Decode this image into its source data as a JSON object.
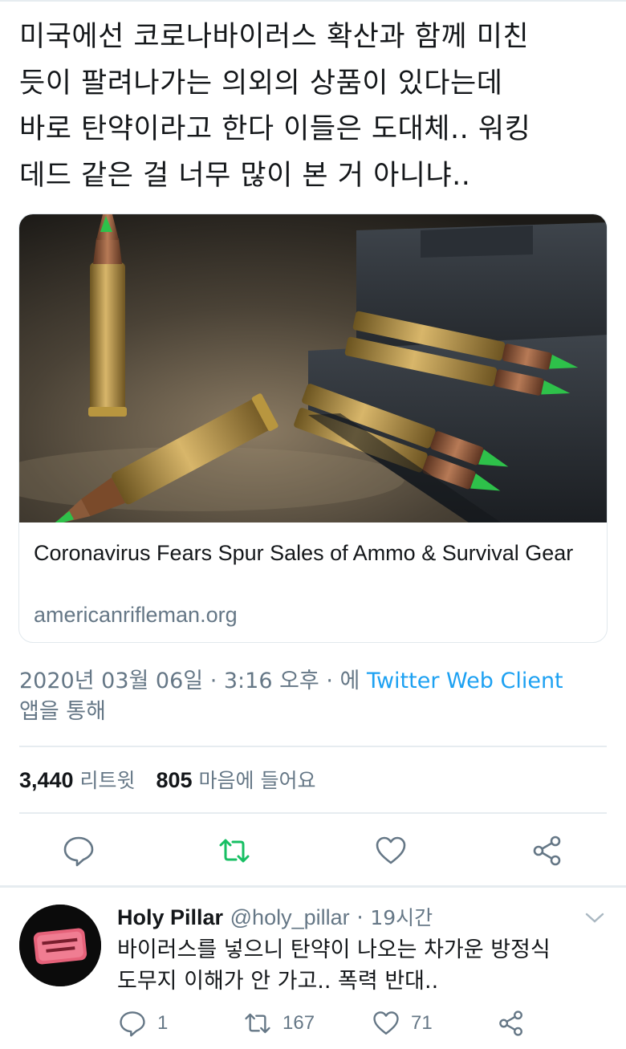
{
  "tweet": {
    "text": "미국에선 코로나바이러스 확산과 함께 미친\n듯이 팔려나가는 의외의 상품이 있다는데\n바로 탄약이라고 한다 이들은 도대체.. 워킹\n데드 같은 걸 너무 많이 본 거 아니냐..",
    "card": {
      "image_icon": "ammunition-photo",
      "title": "Coronavirus Fears Spur Sales of Ammo & Survival Gear",
      "domain": "americanrifleman.org"
    },
    "meta": {
      "date": "2020년 03월 06일",
      "sep1": " · ",
      "time": "3:16 오후",
      "sep2": " · 에 ",
      "client": "Twitter Web Client",
      "suffix": "앱을 통해"
    },
    "stats": {
      "retweets_count": "3,440",
      "retweets_label": "리트윗",
      "likes_count": "805",
      "likes_label": "마음에 들어요"
    },
    "actions": [
      {
        "name": "reply",
        "icon": "comment-icon"
      },
      {
        "name": "retweet",
        "icon": "retweet-icon"
      },
      {
        "name": "like",
        "icon": "heart-icon"
      },
      {
        "name": "share",
        "icon": "share-icon"
      }
    ]
  },
  "reply": {
    "avatar_icon": "fight-club-soap-avatar",
    "name": "Holy Pillar",
    "handle": "@holy_pillar",
    "separator": " · ",
    "time": "19시간",
    "text": "바이러스를 넣으니 탄약이 나오는 차가운 방정식\n도무지 이해가 안 가고.. 폭력 반대..",
    "reply_count": "1",
    "retweet_count": "167",
    "like_count": "71"
  },
  "colors": {
    "text": "#14171a",
    "secondary": "#657786",
    "link": "#1da1f2",
    "retweet_active": "#17bf63",
    "border": "#e1e8ed"
  }
}
